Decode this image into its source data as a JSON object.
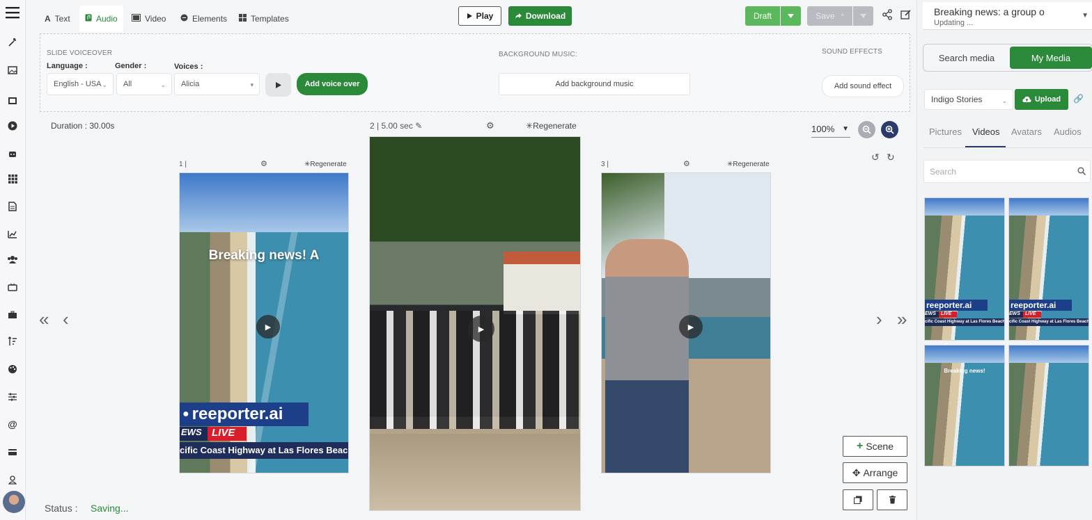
{
  "rail": {
    "icons": [
      "menu-icon",
      "magic-icon",
      "image-icon",
      "film-icon",
      "play-circle-icon",
      "robot-icon",
      "grid-icon",
      "document-icon",
      "chart-icon",
      "users-icon",
      "tv-icon",
      "briefcase-icon",
      "sort-icon",
      "palette-icon",
      "sliders-icon",
      "at-icon",
      "card-icon",
      "user-outline-icon"
    ]
  },
  "toolbar": {
    "tabs": [
      {
        "label": "Text",
        "icon": "text-icon"
      },
      {
        "label": "Audio",
        "icon": "audio-icon"
      },
      {
        "label": "Video",
        "icon": "video-icon"
      },
      {
        "label": "Elements",
        "icon": "elements-icon"
      },
      {
        "label": "Templates",
        "icon": "templates-icon"
      }
    ],
    "play_label": "Play",
    "download_label": "Download",
    "draft_label": "Draft",
    "save_label": "Save"
  },
  "audio": {
    "slide_voiceover": "SLIDE VOICEOVER",
    "language_label": "Language :",
    "language_value": "English - USA",
    "gender_label": "Gender :",
    "gender_value": "All",
    "voices_label": "Voices :",
    "voices_value": "Alicia",
    "add_voice_label": "Add voice over",
    "bg_music_title": "BACKGROUND MUSIC:",
    "add_bg_label": "Add background music",
    "sfx_title": "SOUND EFFECTS",
    "add_sfx_label": "Add sound effect"
  },
  "stage": {
    "duration": "Duration : 30.00s",
    "zoom": "100%",
    "regenerate": "Regenerate",
    "scenes": [
      {
        "index": "1 |"
      },
      {
        "index": "2 |",
        "duration": "5.00 sec"
      },
      {
        "index": "3 |"
      }
    ],
    "scene1": {
      "headline": "Breaking news! A",
      "brand": "reeporter.ai",
      "news": "EWS",
      "live": "LIVE",
      "caption": "cific Coast Highway at Las Flores Beach"
    },
    "scene_label": "Scene",
    "arrange_label": "Arrange",
    "status_label": "Status :",
    "status_value": "Saving..."
  },
  "sidebar": {
    "project_title": "Breaking news: a group o",
    "project_status": "Updating ...",
    "search_media": "Search media",
    "my_media": "My Media",
    "folder": "Indigo Stories",
    "upload_label": "Upload",
    "tabs": [
      "Pictures",
      "Videos",
      "Avatars",
      "Audios"
    ],
    "search_placeholder": "Search",
    "thumbs": [
      {
        "brand": "reeporter.ai",
        "news": "EWS",
        "live": "LIVE",
        "caption": "cific Coast Highway at Las Flores Beach"
      },
      {
        "brand": "reeporter.ai",
        "news": "EWS",
        "live": "LIVE",
        "caption": "cific Coast Highway at Las Flores Beach"
      },
      {
        "headline": "Breaking news!"
      },
      {}
    ]
  }
}
